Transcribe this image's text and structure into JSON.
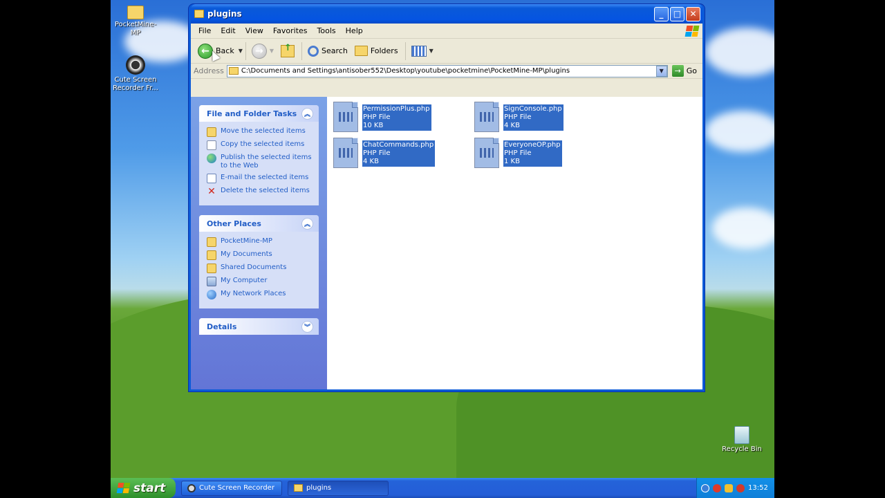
{
  "window": {
    "title": "plugins",
    "menu": [
      "File",
      "Edit",
      "View",
      "Favorites",
      "Tools",
      "Help"
    ]
  },
  "toolbar": {
    "back_label": "Back",
    "search_label": "Search",
    "folders_label": "Folders"
  },
  "address": {
    "label": "Address",
    "path": "C:\\Documents and Settings\\antisober552\\Desktop\\youtube\\pocketmine\\PocketMine-MP\\plugins",
    "go_label": "Go"
  },
  "file_tasks": {
    "title": "File and Folder Tasks",
    "items": [
      {
        "label": "Move the selected items",
        "icon": "move-icon"
      },
      {
        "label": "Copy the selected items",
        "icon": "copy-icon"
      },
      {
        "label": "Publish the selected items to the Web",
        "icon": "globe-icon"
      },
      {
        "label": "E-mail the selected items",
        "icon": "email-icon"
      },
      {
        "label": "Delete the selected items",
        "icon": "delete-icon"
      }
    ]
  },
  "other_places": {
    "title": "Other Places",
    "items": [
      {
        "label": "PocketMine-MP",
        "icon": "folder-icon"
      },
      {
        "label": "My Documents",
        "icon": "folder-icon"
      },
      {
        "label": "Shared Documents",
        "icon": "folder-icon"
      },
      {
        "label": "My Computer",
        "icon": "computer-icon"
      },
      {
        "label": "My Network Places",
        "icon": "network-icon"
      }
    ]
  },
  "details": {
    "title": "Details"
  },
  "files": [
    {
      "name": "PermissionPlus.php",
      "type": "PHP File",
      "size": "10 KB"
    },
    {
      "name": "SignConsole.php",
      "type": "PHP File",
      "size": "4 KB"
    },
    {
      "name": "ChatCommands.php",
      "type": "PHP File",
      "size": "4 KB"
    },
    {
      "name": "EveryoneOP.php",
      "type": "PHP File",
      "size": "1 KB"
    }
  ],
  "desktop": {
    "icons": [
      {
        "label": "PocketMine-MP"
      },
      {
        "label": "Cute Screen Recorder Fr..."
      },
      {
        "label": "Recycle Bin"
      }
    ]
  },
  "taskbar": {
    "start_label": "start",
    "buttons": [
      {
        "label": "Cute Screen Recorder"
      },
      {
        "label": "plugins"
      }
    ],
    "clock": "13:52"
  }
}
